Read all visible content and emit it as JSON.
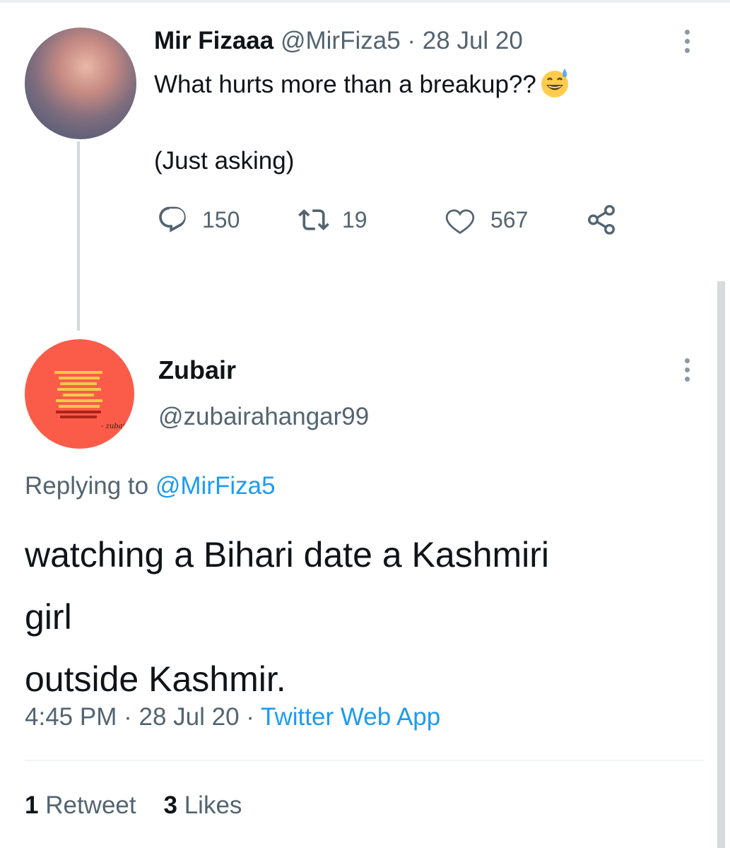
{
  "colors": {
    "link": "#1d9bf0",
    "muted_text": "#536471",
    "primary_text": "#0f1419",
    "avatar_2_background": "#fb5c4a"
  },
  "tweet1": {
    "name": "Mir Fizaaa",
    "handle": "@MirFiza5",
    "separator": "·",
    "date": "28 Jul 20",
    "text_line1": "What hurts more than a breakup??",
    "emoji": "grinning-face-with-sweat-emoji",
    "text_line2": "(Just asking)",
    "actions": {
      "reply_count": "150",
      "retweet_count": "19",
      "like_count": "567"
    },
    "icons": [
      "reply-icon",
      "retweet-icon",
      "like-icon",
      "share-icon",
      "more-options-icon"
    ]
  },
  "tweet2": {
    "name": "Zubair",
    "handle": "@zubairahangar99",
    "replying_prefix": "Replying to",
    "replying_handle": "@MirFiza5",
    "text_lines": [
      "watching a Bihari date a Kashmiri",
      "girl",
      "outside Kashmir."
    ],
    "time": "4:45 PM",
    "separator": "·",
    "date": "28 Jul 20",
    "source": "Twitter Web App",
    "retweets_count": "1",
    "retweets_label": "Retweet",
    "likes_count": "3",
    "likes_label": "Likes",
    "avatar_signature": "- zubair"
  }
}
